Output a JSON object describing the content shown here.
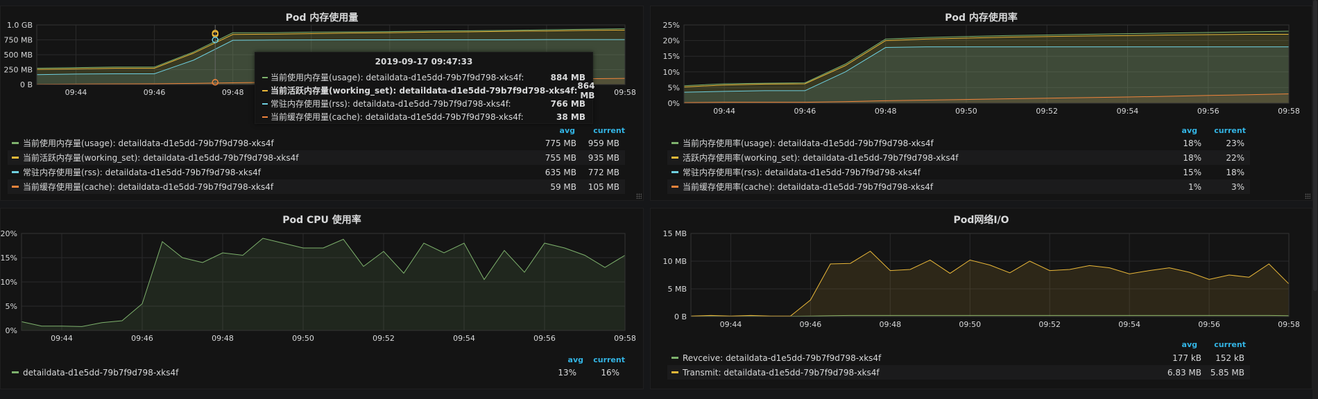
{
  "colors": {
    "green": "#7eb26d",
    "yellow": "#eab839",
    "orange": "#ef843c",
    "blue": "#6ed0e0",
    "grid": "#2a2a2b",
    "header": "#33b5e5"
  },
  "xticks": [
    "09:44",
    "09:46",
    "09:48",
    "09:50",
    "09:52",
    "09:54",
    "09:56",
    "09:58"
  ],
  "panels": {
    "mem_usage": {
      "title": "Pod 内存使用量",
      "yticks": [
        "1.0 GB",
        "750 MB",
        "500 MB",
        "250 MB",
        "0 B"
      ],
      "xticks": [
        "09:44",
        "09:46",
        "09:48",
        "09:50",
        "09:52",
        "09:54",
        "09:56",
        "09:58"
      ],
      "legend": {
        "head_avg": "avg",
        "head_current": "current",
        "rows": [
          {
            "name": "当前使用内存量(usage): detaildata-d1e5dd-79b7f9d798-xks4f",
            "avg": "775 MB",
            "current": "959 MB",
            "color": "#7eb26d"
          },
          {
            "name": "当前活跃内存量(working_set): detaildata-d1e5dd-79b7f9d798-xks4f",
            "avg": "755 MB",
            "current": "935 MB",
            "color": "#eab839"
          },
          {
            "name": "常驻内存使用量(rss): detaildata-d1e5dd-79b7f9d798-xks4f",
            "avg": "635 MB",
            "current": "772 MB",
            "color": "#6ed0e0"
          },
          {
            "name": "当前缓存使用量(cache): detaildata-d1e5dd-79b7f9d798-xks4f",
            "avg": "59 MB",
            "current": "105 MB",
            "color": "#ef843c"
          }
        ]
      },
      "tooltip": {
        "time": "2019-09-17 09:47:33",
        "rows": [
          {
            "name": "当前使用内存量(usage): detaildata-d1e5dd-79b7f9d798-xks4f:",
            "value": "884 MB",
            "color": "#7eb26d",
            "bold": false
          },
          {
            "name": "当前活跃内存量(working_set): detaildata-d1e5dd-79b7f9d798-xks4f:",
            "value": "864 MB",
            "color": "#eab839",
            "bold": true
          },
          {
            "name": "常驻内存使用量(rss): detaildata-d1e5dd-79b7f9d798-xks4f:",
            "value": "766 MB",
            "color": "#6ed0e0",
            "bold": false
          },
          {
            "name": "当前缓存使用量(cache): detaildata-d1e5dd-79b7f9d798-xks4f:",
            "value": "38 MB",
            "color": "#ef843c",
            "bold": false
          }
        ]
      }
    },
    "mem_rate": {
      "title": "Pod 内存使用率",
      "yticks": [
        "25%",
        "20%",
        "15%",
        "10%",
        "5%",
        "0%"
      ],
      "xticks": [
        "09:44",
        "09:46",
        "09:48",
        "09:50",
        "09:52",
        "09:54",
        "09:56",
        "09:58"
      ],
      "legend": {
        "head_avg": "avg",
        "head_current": "current",
        "rows": [
          {
            "name": "当前内存使用率(usage): detaildata-d1e5dd-79b7f9d798-xks4f",
            "avg": "18%",
            "current": "23%",
            "color": "#7eb26d"
          },
          {
            "name": "活跃内存使用率(working_set): detaildata-d1e5dd-79b7f9d798-xks4f",
            "avg": "18%",
            "current": "22%",
            "color": "#eab839"
          },
          {
            "name": "常驻内存使用率(rss): detaildata-d1e5dd-79b7f9d798-xks4f",
            "avg": "15%",
            "current": "18%",
            "color": "#6ed0e0"
          },
          {
            "name": "当前缓存使用率(cache): detaildata-d1e5dd-79b7f9d798-xks4f",
            "avg": "1%",
            "current": "3%",
            "color": "#ef843c"
          }
        ]
      }
    },
    "cpu": {
      "title": "Pod CPU 使用率",
      "yticks": [
        "20%",
        "15%",
        "10%",
        "5%",
        "0%"
      ],
      "xticks": [
        "09:44",
        "09:46",
        "09:48",
        "09:50",
        "09:52",
        "09:54",
        "09:56",
        "09:58"
      ],
      "legend": {
        "head_avg": "avg",
        "head_current": "current",
        "rows": [
          {
            "name": "detaildata-d1e5dd-79b7f9d798-xks4f",
            "avg": "13%",
            "current": "16%",
            "color": "#7eb26d"
          }
        ]
      }
    },
    "net": {
      "title": "Pod网络I/O",
      "yticks": [
        "15 MB",
        "10 MB",
        "5 MB",
        "0 B"
      ],
      "xticks": [
        "09:44",
        "09:46",
        "09:48",
        "09:50",
        "09:52",
        "09:54",
        "09:56",
        "09:58"
      ],
      "legend": {
        "head_avg": "avg",
        "head_current": "current",
        "rows": [
          {
            "name": "Revceive: detaildata-d1e5dd-79b7f9d798-xks4f",
            "avg": "177 kB",
            "current": "152 kB",
            "color": "#7eb26d"
          },
          {
            "name": "Transmit: detaildata-d1e5dd-79b7f9d798-xks4f",
            "avg": "6.83 MB",
            "current": "5.85 MB",
            "color": "#eab839"
          }
        ]
      }
    }
  },
  "chart_data": [
    {
      "type": "area",
      "title": "Pod 内存使用量",
      "x_range": [
        "09:43",
        "09:58"
      ],
      "ylim_mb": [
        0,
        1024
      ],
      "x": [
        0,
        1,
        2,
        3,
        4,
        5,
        6,
        7,
        8,
        9,
        10,
        11,
        12,
        13,
        14,
        15
      ],
      "series": [
        {
          "name": "当前使用内存量(usage): detaildata-d1e5dd-79b7f9d798-xks4f",
          "values_mb": [
            280,
            290,
            300,
            300,
            560,
            890,
            890,
            900,
            905,
            910,
            920,
            925,
            930,
            940,
            950,
            959
          ]
        },
        {
          "name": "当前活跃内存量(working_set): detaildata-d1e5dd-79b7f9d798-xks4f",
          "values_mb": [
            260,
            270,
            280,
            280,
            540,
            860,
            865,
            875,
            885,
            890,
            900,
            905,
            915,
            920,
            930,
            935
          ]
        },
        {
          "name": "常驻内存使用量(rss): detaildata-d1e5dd-79b7f9d798-xks4f",
          "values_mb": [
            170,
            180,
            185,
            185,
            420,
            760,
            765,
            766,
            768,
            768,
            770,
            770,
            770,
            772,
            772,
            772
          ]
        },
        {
          "name": "当前缓存使用量(cache): detaildata-d1e5dd-79b7f9d798-xks4f",
          "values_mb": [
            5,
            8,
            10,
            12,
            20,
            30,
            38,
            45,
            55,
            62,
            70,
            78,
            85,
            92,
            100,
            105
          ]
        }
      ]
    },
    {
      "type": "area",
      "title": "Pod 内存使用率",
      "x_range": [
        "09:43",
        "09:58"
      ],
      "ylim": [
        0,
        25
      ],
      "x": [
        0,
        1,
        2,
        3,
        4,
        5,
        6,
        7,
        8,
        9,
        10,
        11,
        12,
        13,
        14,
        15
      ],
      "series": [
        {
          "name": "当前内存使用率(usage): detaildata-d1e5dd-79b7f9d798-xks4f",
          "values": [
            5.6,
            6.2,
            6.4,
            6.5,
            12.5,
            20.5,
            21.0,
            21.3,
            21.6,
            21.8,
            22.0,
            22.2,
            22.4,
            22.6,
            22.8,
            23.0
          ]
        },
        {
          "name": "活跃内存使用率(working_set): detaildata-d1e5dd-79b7f9d798-xks4f",
          "values": [
            5.2,
            5.8,
            6.1,
            6.2,
            12.0,
            20.0,
            20.5,
            20.8,
            21.1,
            21.3,
            21.5,
            21.6,
            21.8,
            21.9,
            22.0,
            22.0
          ]
        },
        {
          "name": "常驻内存使用率(rss): detaildata-d1e5dd-79b7f9d798-xks4f",
          "values": [
            3.5,
            3.8,
            4.0,
            4.0,
            10.0,
            17.8,
            18.0,
            18.0,
            18.0,
            18.0,
            18.0,
            18.0,
            18.0,
            18.0,
            18.0,
            18.0
          ]
        },
        {
          "name": "当前缓存使用率(cache): detaildata-d1e5dd-79b7f9d798-xks4f",
          "values": [
            0.2,
            0.3,
            0.3,
            0.3,
            0.5,
            0.8,
            1.0,
            1.2,
            1.4,
            1.6,
            1.8,
            2.0,
            2.2,
            2.5,
            2.7,
            3.0
          ]
        }
      ]
    },
    {
      "type": "area",
      "title": "Pod CPU 使用率",
      "x_range": [
        "09:43",
        "09:58"
      ],
      "ylim": [
        0,
        20
      ],
      "x": [
        0,
        0.5,
        1,
        1.5,
        2,
        2.5,
        3,
        3.5,
        4,
        4.5,
        5,
        5.5,
        6,
        6.5,
        7,
        7.5,
        8,
        8.5,
        9,
        9.5,
        10,
        10.5,
        11,
        11.5,
        12,
        12.5,
        13,
        13.5,
        14,
        14.5,
        15
      ],
      "series": [
        {
          "name": "detaildata-d1e5dd-79b7f9d798-xks4f",
          "values": [
            1.8,
            0.9,
            0.9,
            0.8,
            1.6,
            2.0,
            5.5,
            18.3,
            15.0,
            14.0,
            16.0,
            15.5,
            19.0,
            18.0,
            17.0,
            17.0,
            18.8,
            13.2,
            16.3,
            11.8,
            18.0,
            16.0,
            18.0,
            10.5,
            16.5,
            12.0,
            18.0,
            17.0,
            15.5,
            13.0,
            15.5
          ]
        }
      ]
    },
    {
      "type": "area",
      "title": "Pod网络I/O",
      "x_range": [
        "09:43",
        "09:58"
      ],
      "ylim_mb": [
        0,
        15
      ],
      "x": [
        0,
        0.5,
        1,
        1.5,
        2,
        2.5,
        3,
        3.5,
        4,
        4.5,
        5,
        5.5,
        6,
        6.5,
        7,
        7.5,
        8,
        8.5,
        9,
        9.5,
        10,
        10.5,
        11,
        11.5,
        12,
        12.5,
        13,
        13.5,
        14,
        14.5,
        15
      ],
      "series": [
        {
          "name": "Revceive: detaildata-d1e5dd-79b7f9d798-xks4f",
          "values_mb": [
            0.05,
            0.05,
            0.05,
            0.05,
            0.05,
            0.05,
            0.1,
            0.15,
            0.2,
            0.2,
            0.2,
            0.2,
            0.2,
            0.2,
            0.2,
            0.2,
            0.2,
            0.2,
            0.2,
            0.2,
            0.2,
            0.2,
            0.2,
            0.2,
            0.2,
            0.2,
            0.2,
            0.2,
            0.2,
            0.2,
            0.15
          ]
        },
        {
          "name": "Transmit: detaildata-d1e5dd-79b7f9d798-xks4f",
          "values_mb": [
            0.1,
            0.2,
            0.1,
            0.2,
            0.1,
            0.1,
            3.0,
            9.5,
            9.6,
            11.8,
            8.3,
            8.5,
            10.2,
            7.8,
            10.2,
            9.3,
            7.9,
            10.0,
            8.3,
            8.5,
            9.2,
            8.8,
            7.7,
            8.3,
            8.8,
            8.0,
            6.7,
            7.5,
            7.1,
            9.5,
            5.9
          ]
        }
      ]
    }
  ]
}
